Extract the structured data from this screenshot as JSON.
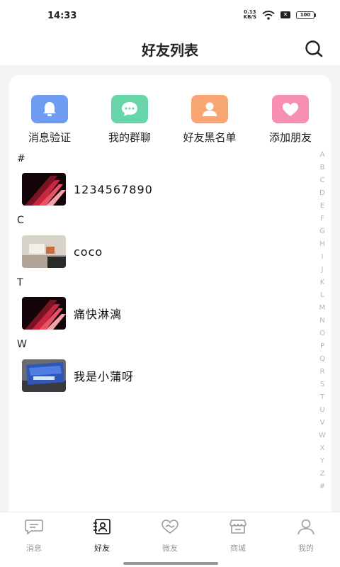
{
  "status_bar": {
    "time": "14:33",
    "net_speed_value": "0.13",
    "net_speed_unit": "KB/S",
    "battery": "100"
  },
  "header": {
    "title": "好友列表"
  },
  "quick_actions": [
    {
      "label": "消息验证",
      "icon": "bell-icon",
      "color": "#6f9bf2"
    },
    {
      "label": "我的群聊",
      "icon": "chat-bubble-icon",
      "color": "#66d6a8"
    },
    {
      "label": "好友黑名单",
      "icon": "user-icon",
      "color": "#f8a572"
    },
    {
      "label": "添加朋友",
      "icon": "heart-icon",
      "color": "#f78fb0"
    }
  ],
  "sections": [
    {
      "letter": "#",
      "contacts": [
        {
          "name": "1234567890"
        }
      ]
    },
    {
      "letter": "C",
      "contacts": [
        {
          "name": "coco"
        }
      ]
    },
    {
      "letter": "T",
      "contacts": [
        {
          "name": "痛快淋漓"
        }
      ]
    },
    {
      "letter": "W",
      "contacts": [
        {
          "name": "我是小蒲呀"
        }
      ]
    }
  ],
  "alpha_index": [
    "A",
    "B",
    "C",
    "D",
    "E",
    "F",
    "G",
    "H",
    "I",
    "J",
    "K",
    "L",
    "M",
    "N",
    "O",
    "P",
    "Q",
    "R",
    "S",
    "T",
    "U",
    "V",
    "W",
    "X",
    "Y",
    "Z",
    "#"
  ],
  "tabs": [
    {
      "label": "消息",
      "icon": "message-icon"
    },
    {
      "label": "好友",
      "icon": "contacts-icon",
      "active": true
    },
    {
      "label": "微友",
      "icon": "heart-hands-icon"
    },
    {
      "label": "商城",
      "icon": "store-icon"
    },
    {
      "label": "我的",
      "icon": "profile-icon"
    }
  ]
}
